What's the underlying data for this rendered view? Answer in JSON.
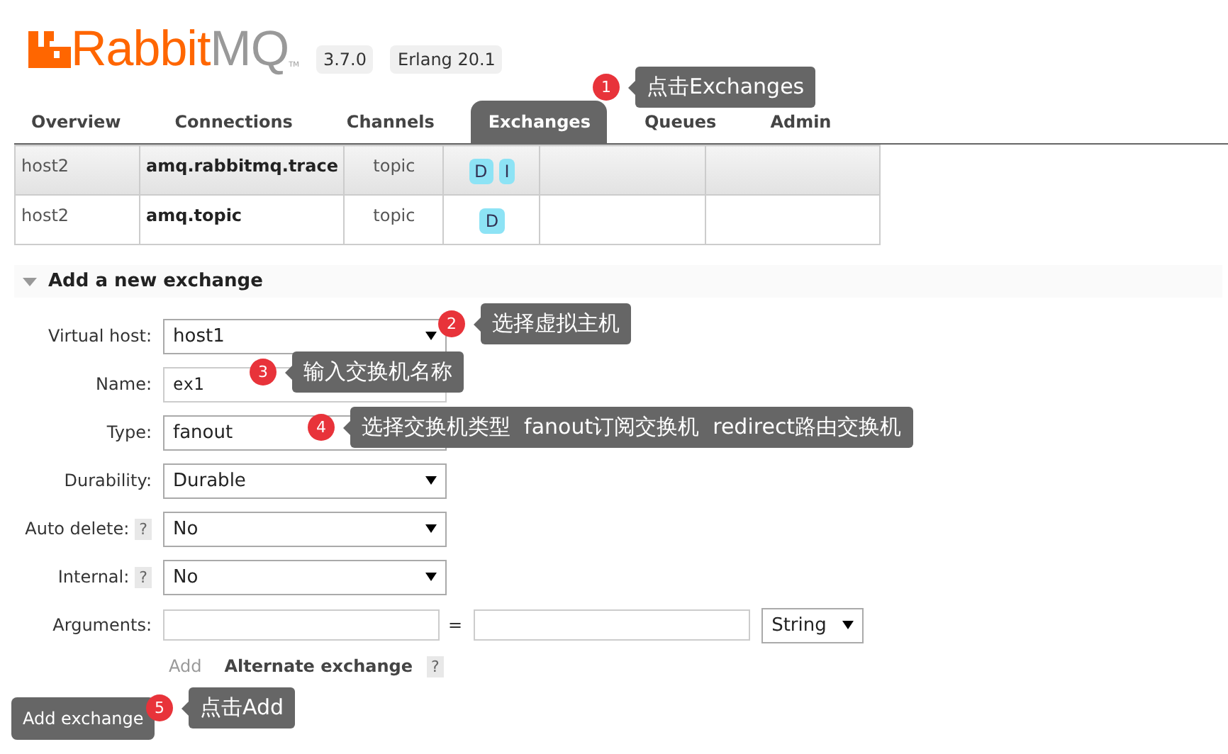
{
  "header": {
    "logo_text": "RabbitMQ",
    "logo_tm": "TM",
    "version": "3.7.0",
    "erlang": "Erlang 20.1"
  },
  "tabs": [
    {
      "label": "Overview",
      "selected": false
    },
    {
      "label": "Connections",
      "selected": false
    },
    {
      "label": "Channels",
      "selected": false
    },
    {
      "label": "Exchanges",
      "selected": true
    },
    {
      "label": "Queues",
      "selected": false
    },
    {
      "label": "Admin",
      "selected": false
    }
  ],
  "table": {
    "rows": [
      {
        "vhost": "host2",
        "name": "amq.rabbitmq.trace",
        "type": "topic",
        "features": [
          "D",
          "I"
        ]
      },
      {
        "vhost": "host2",
        "name": "amq.topic",
        "type": "topic",
        "features": [
          "D"
        ]
      }
    ]
  },
  "section": {
    "title": "Add a new exchange",
    "expanded": true
  },
  "form": {
    "fields": [
      {
        "kind": "select",
        "label": "Virtual host:",
        "value": "host1",
        "help": false
      },
      {
        "kind": "input",
        "label": "Name:",
        "value": "ex1",
        "help": false
      },
      {
        "kind": "select",
        "label": "Type:",
        "value": "fanout",
        "help": false
      },
      {
        "kind": "select",
        "label": "Durability:",
        "value": "Durable",
        "help": false
      },
      {
        "kind": "select",
        "label": "Auto delete:",
        "value": "No",
        "help": true
      },
      {
        "kind": "select",
        "label": "Internal:",
        "value": "No",
        "help": true
      }
    ],
    "arguments": {
      "label": "Arguments:",
      "equals": "=",
      "type": "String"
    },
    "add_link": "Add",
    "alternate": "Alternate exchange",
    "submit": "Add exchange"
  },
  "help_mark": "?",
  "callouts": [
    {
      "number": "1",
      "text": "点击Exchanges"
    },
    {
      "number": "2",
      "text": "选择虚拟主机"
    },
    {
      "number": "3",
      "text": "输入交换机名称"
    },
    {
      "number": "4",
      "text": "选择交换机类型  fanout订阅交换机  redirect路由交换机"
    },
    {
      "number": "5",
      "text": "点击Add"
    }
  ]
}
